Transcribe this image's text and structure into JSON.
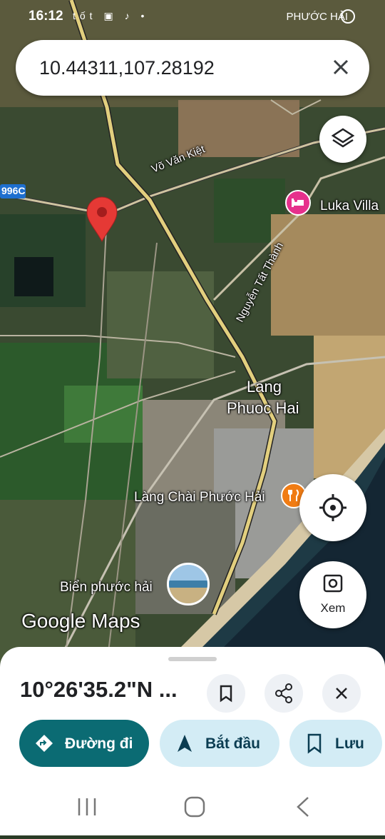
{
  "status_bar": {
    "time": "16:12",
    "notification_icons": "tốt ▣ ♪ •",
    "location_text": "PHƯỚC HẢI"
  },
  "search": {
    "query": "10.44311,107.28192"
  },
  "map": {
    "labels": {
      "road_996c": "996C",
      "vo_van_kiet": "Võ Văn Kiệt",
      "nguyen_tat_thanh": "Nguyễn Tất Thành",
      "luka_villa": "Luka Villa",
      "lang_phuoc_hai_line1": "Lang",
      "lang_phuoc_hai_line2": "Phuoc Hai",
      "lang_chai": "Làng Chài Phước Hải",
      "bien_phuoc_hai": "Biển phước hải",
      "google_maps": "Google Maps"
    }
  },
  "buttons": {
    "xem_label": "Xem"
  },
  "sheet": {
    "coordinate": "10°26'35.2\"N ...",
    "actions": {
      "directions": "Đường đi",
      "start": "Bắt đầu",
      "save": "Lưu"
    }
  },
  "colors": {
    "primary_teal": "#0b6b73",
    "light_teal": "#d3ecf5",
    "pin_red": "#e53935",
    "hotel_pink": "#e6308c",
    "food_orange": "#f07c14"
  }
}
